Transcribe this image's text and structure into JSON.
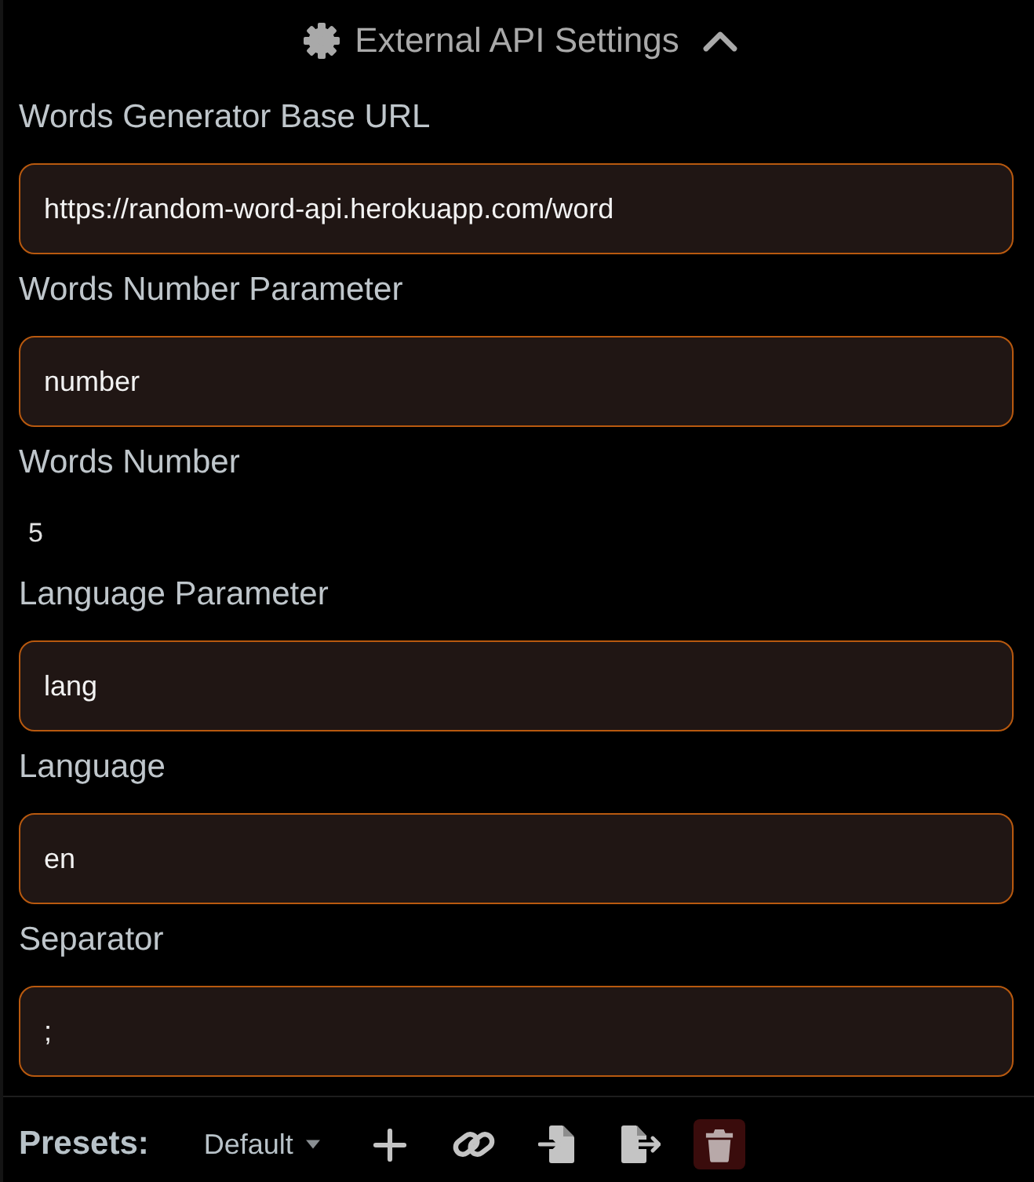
{
  "header": {
    "title": "External API Settings",
    "expanded": true
  },
  "fields": [
    {
      "kind": "text",
      "label": "Words Generator Base URL",
      "value": "https://random-word-api.herokuapp.com/word"
    },
    {
      "kind": "text",
      "label": "Words Number Parameter",
      "value": "number"
    },
    {
      "kind": "number",
      "label": "Words Number",
      "value": "5"
    },
    {
      "kind": "text",
      "label": "Language Parameter",
      "value": "lang"
    },
    {
      "kind": "text",
      "label": "Language",
      "value": "en"
    },
    {
      "kind": "text",
      "label": "Separator",
      "value": ";"
    }
  ],
  "presets": {
    "label": "Presets:",
    "current": "Default"
  }
}
